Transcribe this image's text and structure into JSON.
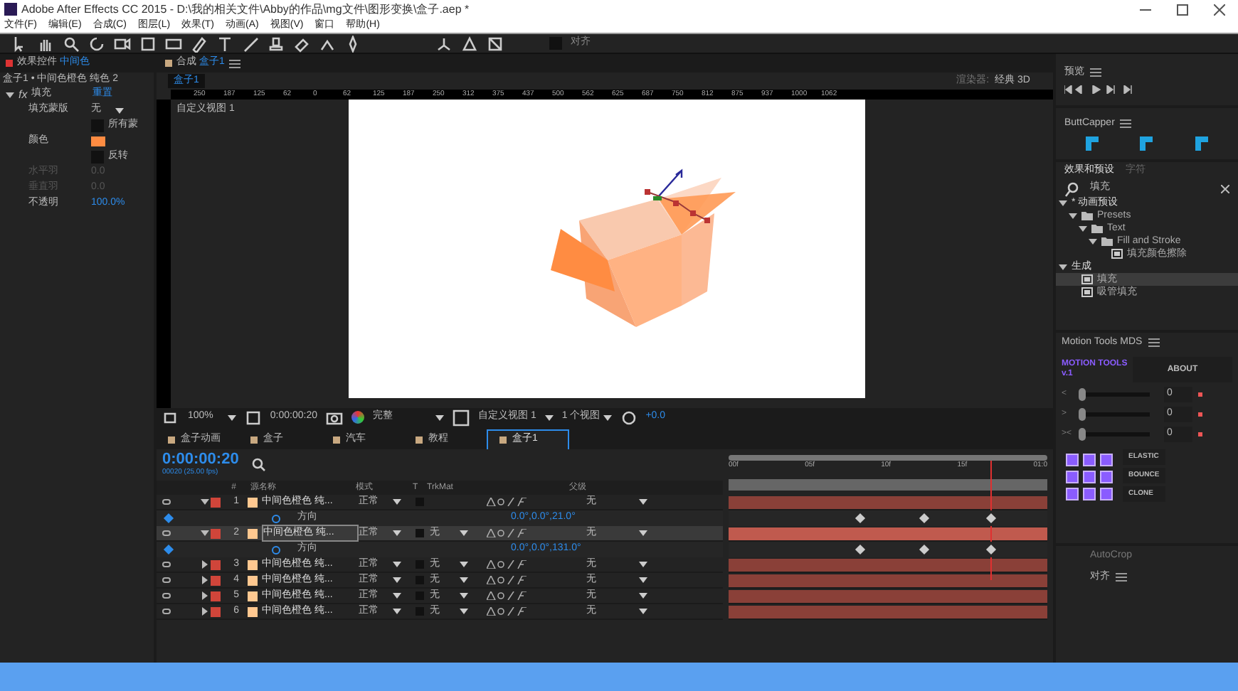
{
  "window": {
    "title": "Adobe After Effects CC 2015 - D:\\我的相关文件\\Abby的作品\\mg文件\\图形变换\\盒子.aep *"
  },
  "menu": [
    "文件(F)",
    "编辑(E)",
    "合成(C)",
    "图层(L)",
    "效果(T)",
    "动画(A)",
    "视图(V)",
    "窗口",
    "帮助(H)"
  ],
  "toolbar": {
    "snap": {
      "label": "对齐",
      "checked": false
    }
  },
  "effect_controls": {
    "tab": "效果控件",
    "tab_target": "中间色",
    "layer_path": "盒子1 • 中间色橙色 纯色 2",
    "effect": {
      "fx": "fx",
      "name": "填充",
      "reset": "重置",
      "expanded": true
    },
    "props": [
      {
        "kind": "dropdown",
        "label": "填充蒙版",
        "value": "无"
      },
      {
        "kind": "checkbox",
        "label": "所有蒙",
        "checked": false
      },
      {
        "kind": "color",
        "label": "颜色",
        "color": "#ff8c42"
      },
      {
        "kind": "checkbox",
        "label": "反转",
        "checked": false
      },
      {
        "kind": "number",
        "label": "水平羽",
        "value": "0.0",
        "disabled": true
      },
      {
        "kind": "number",
        "label": "垂直羽",
        "value": "0.0",
        "disabled": true
      },
      {
        "kind": "number",
        "label": "不透明",
        "value": "100.0%",
        "disabled": false
      }
    ]
  },
  "composition": {
    "tab": "合成",
    "tab_target": "盒子1",
    "subtab": "盒子1",
    "renderer_label": "渲染器:",
    "renderer": "经典 3D",
    "view_label": "自定义视图 1",
    "ruler": [
      "250",
      "187",
      "125",
      "62",
      "0",
      "62",
      "125",
      "187",
      "250",
      "312",
      "375",
      "437",
      "500",
      "562",
      "625",
      "687",
      "750",
      "812",
      "875",
      "937",
      "1000",
      "1062"
    ],
    "footer": {
      "zoom": "100%",
      "time": "0:00:00:20",
      "quality": "完整",
      "view": "自定义视图 1",
      "views": "1 个视图",
      "exposure": "+0.0"
    }
  },
  "timeline": {
    "tabs": [
      {
        "label": "盒子动画",
        "selected": false
      },
      {
        "label": "盒子",
        "selected": false
      },
      {
        "label": "汽车",
        "selected": false
      },
      {
        "label": "教程",
        "selected": false
      },
      {
        "label": "盒子1",
        "selected": true
      }
    ],
    "timecode": "0:00:00:20",
    "frames": "00020 (25.00 fps)",
    "columns": {
      "num": "#",
      "source": "源名称",
      "mode": "模式",
      "t": "T",
      "trkmat": "TrkMat",
      "parent": "父级"
    },
    "ruler": [
      "00f",
      "05f",
      "10f",
      "15f",
      "01:0"
    ],
    "layers": [
      {
        "num": "1",
        "name": "中间色橙色 纯...",
        "mode": "正常",
        "parent": "无",
        "expanded": true,
        "selected": false,
        "property": {
          "name": "方向",
          "value": "0.0°,0.0°,21.0°"
        }
      },
      {
        "num": "2",
        "name": "中间色橙色 纯...",
        "mode": "正常",
        "trkmat": "无",
        "parent": "无",
        "expanded": true,
        "selected": true,
        "property": {
          "name": "方向",
          "value": "0.0°,0.0°,131.0°"
        }
      },
      {
        "num": "3",
        "name": "中间色橙色 纯...",
        "mode": "正常",
        "trkmat": "无",
        "parent": "无",
        "expanded": false,
        "selected": false
      },
      {
        "num": "4",
        "name": "中间色橙色 纯...",
        "mode": "正常",
        "trkmat": "无",
        "parent": "无",
        "expanded": false,
        "selected": false
      },
      {
        "num": "5",
        "name": "中间色橙色 纯...",
        "mode": "正常",
        "trkmat": "无",
        "parent": "无",
        "expanded": false,
        "selected": false
      },
      {
        "num": "6",
        "name": "中间色橙色 纯...",
        "mode": "正常",
        "trkmat": "无",
        "parent": "无",
        "expanded": false,
        "selected": false
      }
    ]
  },
  "preview": {
    "title": "预览"
  },
  "buttcapper": {
    "title": "ButtCapper"
  },
  "effects_presets": {
    "tabs": [
      {
        "label": "效果和预设",
        "selected": true
      },
      {
        "label": "字符",
        "selected": false
      }
    ],
    "search": "填充",
    "tree": [
      {
        "label": "* 动画预设",
        "kind": "group",
        "selected": false,
        "children": [
          {
            "label": "Presets",
            "kind": "folder",
            "selected": false,
            "children": [
              {
                "label": "Text",
                "kind": "folder",
                "selected": false,
                "children": [
                  {
                    "label": "Fill and Stroke",
                    "kind": "folder",
                    "selected": false,
                    "children": [
                      {
                        "label": "填充颜色擦除",
                        "kind": "preset",
                        "selected": false
                      }
                    ]
                  }
                ]
              }
            ]
          }
        ]
      },
      {
        "label": "生成",
        "kind": "group",
        "selected": false,
        "children": [
          {
            "label": "填充",
            "kind": "effect",
            "selected": true
          },
          {
            "label": "吸管填充",
            "kind": "effect",
            "selected": false
          }
        ]
      }
    ]
  },
  "motion_tools": {
    "title": "Motion Tools MDS",
    "logo": "MOTION TOOLS v.1",
    "about": "ABOUT",
    "sliders": [
      {
        "symbol": "<",
        "level": 0,
        "value": "0"
      },
      {
        "symbol": ">",
        "level": 0,
        "value": "0"
      },
      {
        "symbol": "><",
        "level": 0,
        "value": "0"
      }
    ],
    "actions": [
      "ELASTIC",
      "BOUNCE",
      "CLONE"
    ]
  },
  "bottom_panels": {
    "autocrop": "AutoCrop",
    "align": "对齐"
  }
}
